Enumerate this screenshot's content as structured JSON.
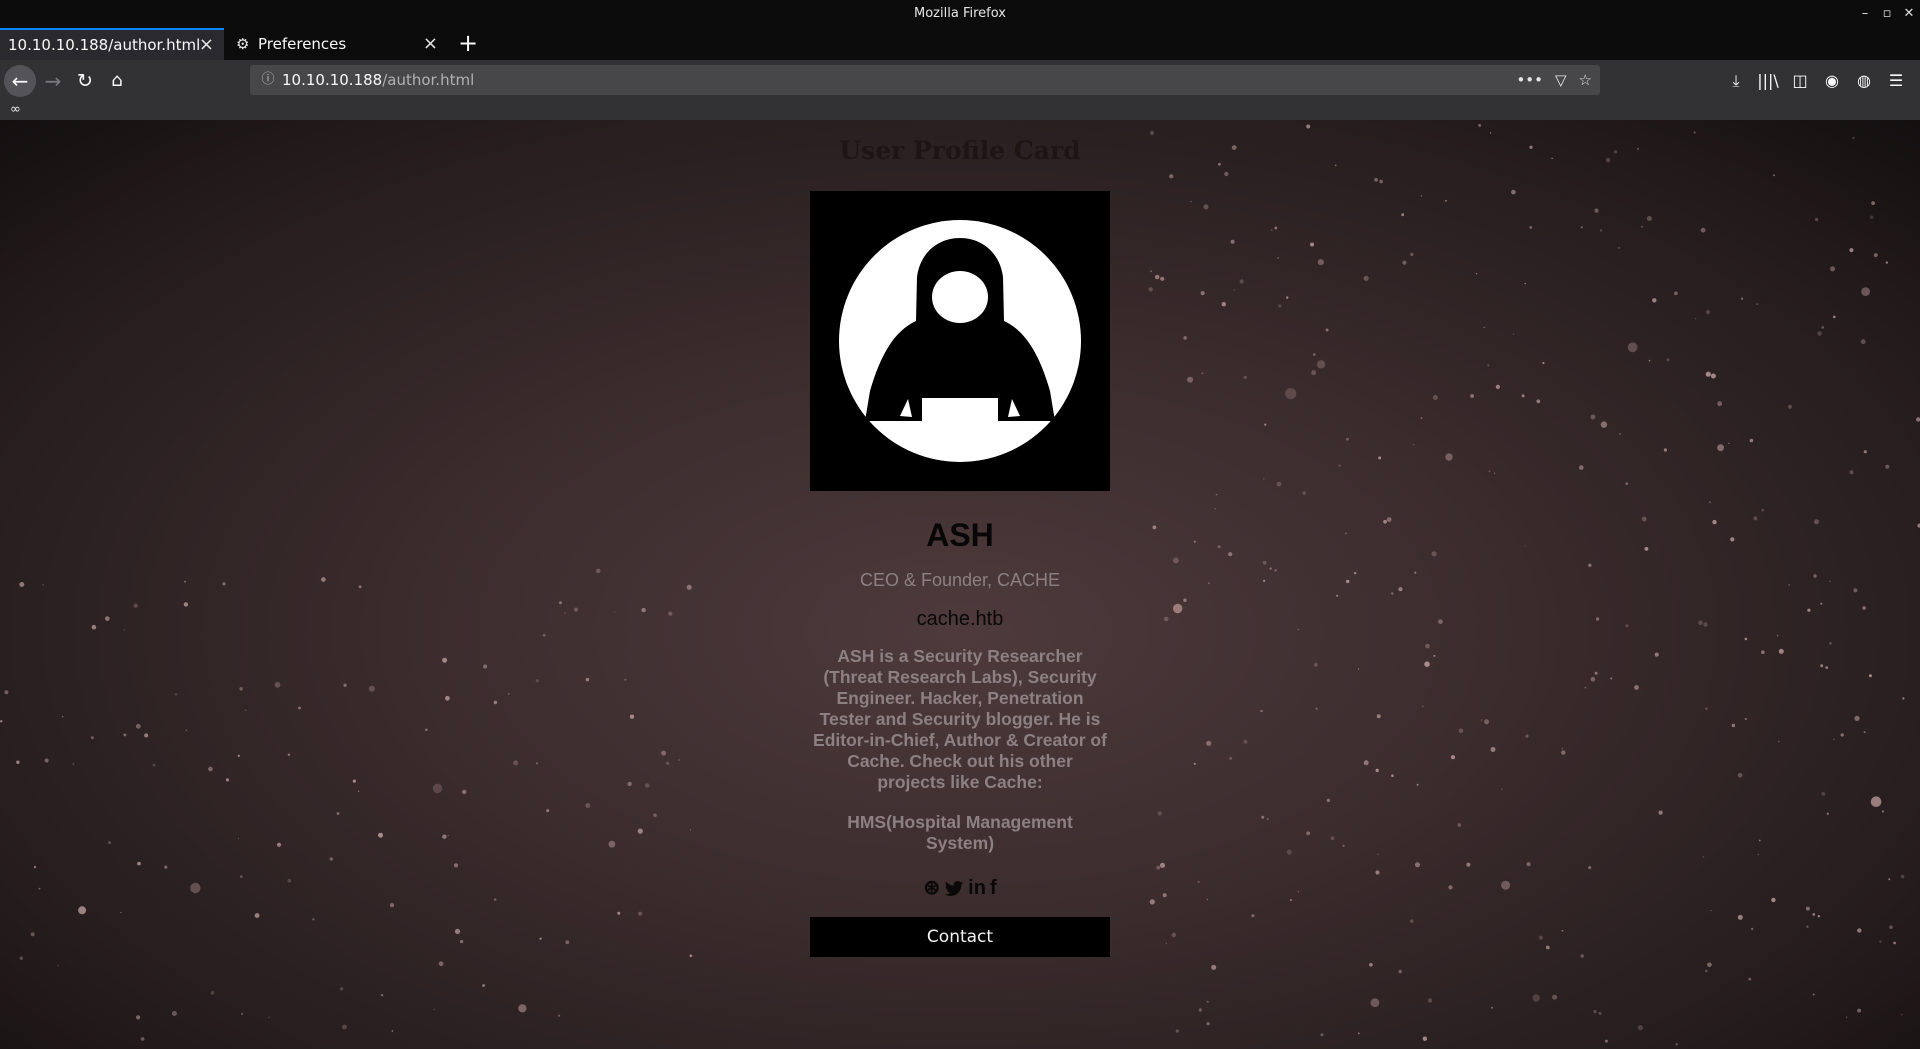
{
  "window": {
    "title": "Mozilla Firefox"
  },
  "tabs": [
    {
      "label": "10.10.10.188/author.html",
      "active": true
    },
    {
      "label": "Preferences",
      "active": false,
      "icon": "gear-icon"
    }
  ],
  "urlbar": {
    "host": "10.10.10.188",
    "path": "/author.html"
  },
  "page": {
    "title": "User Profile Card",
    "name": "ASH",
    "role": "CEO & Founder, CACHE",
    "site": "cache.htb",
    "bio": "ASH is a Security Researcher (Threat Research Labs), Security Engineer. Hacker, Penetration Tester and Security blogger. He is Editor-in-Chief, Author & Creator of Cache. Check out his other projects like Cache:",
    "projects": "HMS(Hospital Management System)",
    "social": {
      "dribbble_icon": "dribbble-icon",
      "twitter_icon": "twitter-icon",
      "linkedin_label": "in",
      "facebook_label": "f"
    },
    "contact_label": "Contact"
  },
  "colors": {
    "accent": "#0a84ff",
    "page_bg": "#3b2c2d",
    "muted_text": "#8c8082"
  }
}
